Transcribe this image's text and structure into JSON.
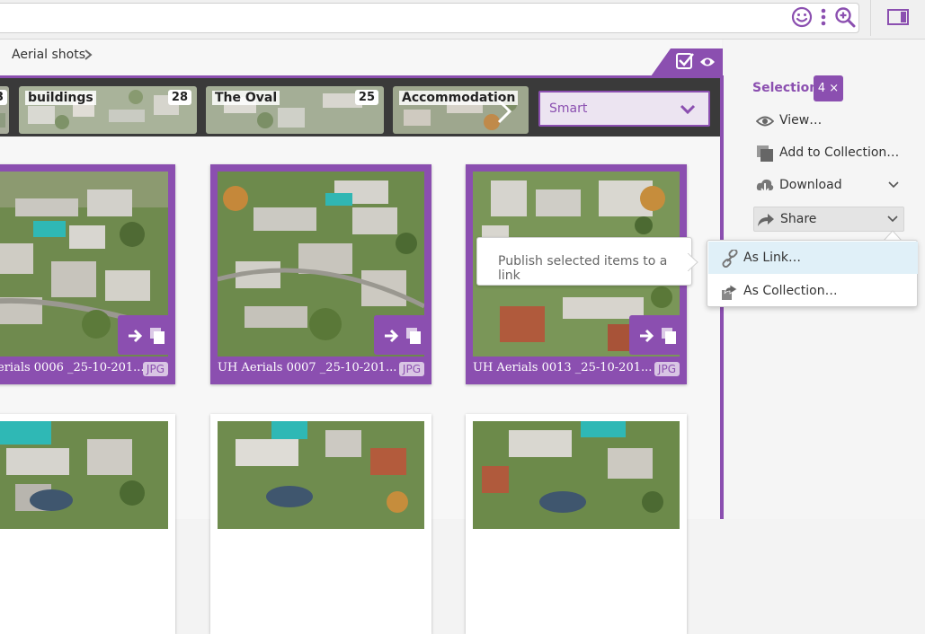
{
  "colors": {
    "accent": "#8b4fb0",
    "accent_light": "#ece4f1",
    "dark_bar": "#3a3a3a",
    "menu_highlight": "#e0f0f8"
  },
  "toolbar": {
    "icons": [
      "smiley-icon",
      "more-vertical-icon",
      "zoom-in-icon",
      "panel-toggle-icon"
    ]
  },
  "breadcrumb": {
    "label": "Aerial shots"
  },
  "collections": [
    {
      "label": "",
      "count": "3"
    },
    {
      "label": "buildings",
      "count": "28"
    },
    {
      "label": "The Oval",
      "count": "25"
    },
    {
      "label": "Accommodation",
      "count": ""
    }
  ],
  "sort": {
    "selected": "Smart"
  },
  "cards": [
    {
      "caption": "erials 0006 _25-10-201...",
      "type": "JPG"
    },
    {
      "caption": "UH Aerials 0007 _25-10-201...",
      "type": "JPG"
    },
    {
      "caption": "UH Aerials 0013 _25-10-201...",
      "type": "JPG"
    }
  ],
  "tooltip": {
    "text": "Publish selected items to a link"
  },
  "sidebar": {
    "selection_label": "Selection",
    "selection_count": "4 ×",
    "items": [
      {
        "label": "View…",
        "icon": "eye-icon"
      },
      {
        "label": "Add to Collection…",
        "icon": "collection-icon"
      },
      {
        "label": "Download",
        "icon": "cloud-download-icon"
      },
      {
        "label": "Share",
        "icon": "share-arrow-icon"
      }
    ]
  },
  "share_menu": {
    "items": [
      {
        "label": "As Link…",
        "icon": "link-icon"
      },
      {
        "label": "As Collection…",
        "icon": "share-collection-icon"
      }
    ]
  }
}
